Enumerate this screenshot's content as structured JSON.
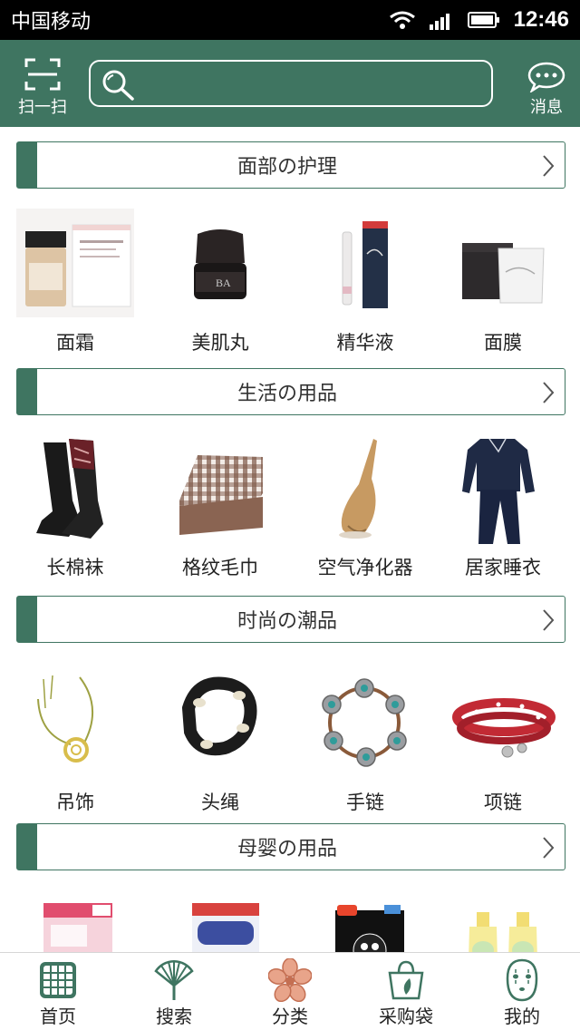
{
  "status_bar": {
    "carrier": "中国移动",
    "time": "12:46"
  },
  "header": {
    "scan_label": "扫一扫",
    "search_placeholder": "",
    "message_label": "消息"
  },
  "sections": [
    {
      "title": "面部の护理",
      "items": [
        "面霜",
        "美肌丸",
        "精华液",
        "面膜"
      ]
    },
    {
      "title": "生活の用品",
      "items": [
        "长棉袜",
        "格纹毛巾",
        "空气净化器",
        "居家睡衣"
      ]
    },
    {
      "title": "时尚の潮品",
      "items": [
        "吊饰",
        "头绳",
        "手链",
        "项链"
      ]
    },
    {
      "title": "母婴の用品",
      "items": [
        "",
        "",
        "",
        ""
      ]
    }
  ],
  "bottom_nav": [
    {
      "label": "首页",
      "icon": "home-grid-icon"
    },
    {
      "label": "搜索",
      "icon": "fan-icon"
    },
    {
      "label": "分类",
      "icon": "sakura-icon",
      "active": true
    },
    {
      "label": "采购袋",
      "icon": "shopping-bag-icon"
    },
    {
      "label": "我的",
      "icon": "mask-face-icon"
    }
  ],
  "colors": {
    "brand": "#3f7561",
    "accent": "#e8a48a"
  }
}
